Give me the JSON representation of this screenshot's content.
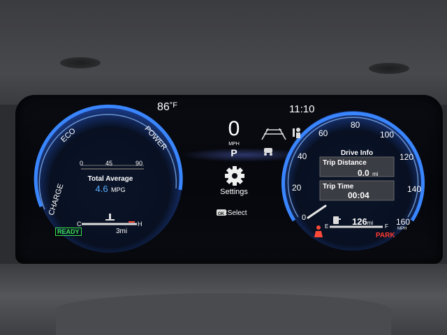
{
  "top": {
    "outside_temp": "86",
    "temp_unit": "°F",
    "clock": "11:10"
  },
  "left_gauge": {
    "zone_eco": "ECO",
    "zone_power": "POWER",
    "zone_charge": "CHARGE",
    "mini_scale": [
      "0",
      "45",
      "90"
    ],
    "avg_label": "Total Average",
    "avg_value": "4.6",
    "avg_unit": "MPG",
    "ready": "READY",
    "temp_cold": "C",
    "temp_hot": "H",
    "range": "3mi"
  },
  "center": {
    "speed": "0",
    "speed_unit": "MPH",
    "gear": "P",
    "settings_label": "Settings",
    "select_key": "OK",
    "select_hint": ":Select"
  },
  "right_gauge": {
    "ticks": [
      "0",
      "20",
      "40",
      "60",
      "80",
      "100",
      "120",
      "140",
      "160"
    ],
    "unit": "MPH",
    "panel_title": "Drive Info",
    "trip_distance_label": "Trip Distance",
    "trip_distance_value": "0.0",
    "trip_distance_unit": "mi",
    "trip_time_label": "Trip Time",
    "trip_time_value": "00:04",
    "fuel_range": "126",
    "fuel_range_unit": "mi",
    "fuel_empty": "E",
    "fuel_full": "F",
    "park": "PARK"
  },
  "colors": {
    "accent": "#2f7dff",
    "ready": "#39e04a",
    "park": "#ff3b30"
  }
}
